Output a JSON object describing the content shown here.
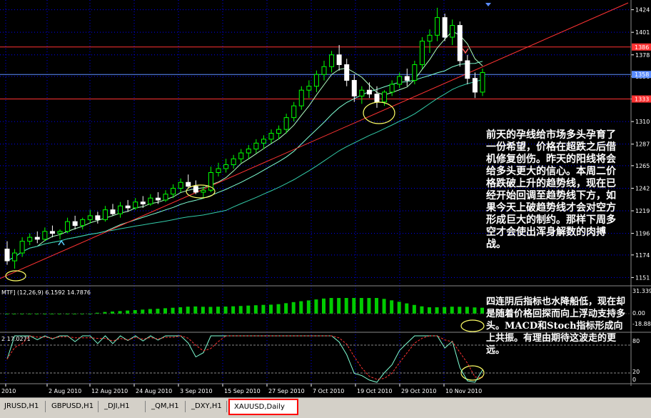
{
  "chart_data": {
    "type": "candlestick",
    "symbol_tab": "XAUUSD,Daily",
    "price_axis_ticks": [
      "1424",
      "1401",
      "1378",
      "1356",
      "1333",
      "1310",
      "1287",
      "1265",
      "1242",
      "1219",
      "1196",
      "1174",
      "1151"
    ],
    "price_labels": {
      "resistance": "1386",
      "current": "1358",
      "support": "1333"
    },
    "date_ticks": [
      "2010",
      "2 Aug 2010",
      "12 Aug 2010",
      "24 Aug 2010",
      "3 Sep 2010",
      "15 Sep 2010",
      "27 Sep 2010",
      "7 Oct 2010",
      "19 Oct 2010",
      "29 Oct 2010",
      "10 Nov 2010"
    ],
    "macd": {
      "label": "MTF] (12,26,9) 6.1592 14.7876",
      "ticks": [
        "31.339",
        "0.00",
        "-18.88"
      ]
    },
    "stoch": {
      "label": "2 17.0271",
      "ticks": [
        "80",
        "20",
        "0"
      ]
    },
    "candles": [
      [
        1180,
        1188,
        1164,
        1168
      ],
      [
        1168,
        1180,
        1160,
        1176
      ],
      [
        1176,
        1192,
        1172,
        1188
      ],
      [
        1188,
        1196,
        1184,
        1192
      ],
      [
        1192,
        1198,
        1186,
        1190
      ],
      [
        1190,
        1202,
        1188,
        1198
      ],
      [
        1198,
        1204,
        1192,
        1196
      ],
      [
        1196,
        1200,
        1190,
        1198
      ],
      [
        1198,
        1212,
        1196,
        1208
      ],
      [
        1208,
        1214,
        1200,
        1204
      ],
      [
        1204,
        1212,
        1200,
        1210
      ],
      [
        1210,
        1220,
        1206,
        1214
      ],
      [
        1214,
        1218,
        1206,
        1210
      ],
      [
        1210,
        1224,
        1208,
        1220
      ],
      [
        1220,
        1226,
        1214,
        1216
      ],
      [
        1216,
        1228,
        1212,
        1224
      ],
      [
        1224,
        1230,
        1218,
        1222
      ],
      [
        1222,
        1232,
        1220,
        1228
      ],
      [
        1228,
        1234,
        1222,
        1226
      ],
      [
        1226,
        1236,
        1224,
        1232
      ],
      [
        1232,
        1238,
        1226,
        1230
      ],
      [
        1230,
        1240,
        1228,
        1236
      ],
      [
        1236,
        1246,
        1232,
        1242
      ],
      [
        1242,
        1252,
        1238,
        1248
      ],
      [
        1248,
        1256,
        1242,
        1244
      ],
      [
        1244,
        1250,
        1236,
        1238
      ],
      [
        1238,
        1244,
        1232,
        1240
      ],
      [
        1240,
        1264,
        1238,
        1258
      ],
      [
        1258,
        1268,
        1254,
        1262
      ],
      [
        1262,
        1272,
        1258,
        1266
      ],
      [
        1266,
        1276,
        1262,
        1272
      ],
      [
        1272,
        1282,
        1268,
        1278
      ],
      [
        1278,
        1286,
        1272,
        1282
      ],
      [
        1282,
        1292,
        1278,
        1288
      ],
      [
        1288,
        1296,
        1282,
        1292
      ],
      [
        1292,
        1302,
        1288,
        1298
      ],
      [
        1298,
        1306,
        1292,
        1302
      ],
      [
        1302,
        1318,
        1298,
        1314
      ],
      [
        1314,
        1330,
        1310,
        1326
      ],
      [
        1326,
        1346,
        1322,
        1342
      ],
      [
        1342,
        1352,
        1334,
        1346
      ],
      [
        1346,
        1362,
        1340,
        1358
      ],
      [
        1358,
        1372,
        1352,
        1366
      ],
      [
        1366,
        1382,
        1360,
        1378
      ],
      [
        1378,
        1388,
        1362,
        1368
      ],
      [
        1368,
        1374,
        1346,
        1352
      ],
      [
        1352,
        1358,
        1330,
        1336
      ],
      [
        1336,
        1346,
        1328,
        1342
      ],
      [
        1342,
        1350,
        1334,
        1338
      ],
      [
        1338,
        1346,
        1324,
        1330
      ],
      [
        1330,
        1342,
        1326,
        1340
      ],
      [
        1340,
        1352,
        1336,
        1348
      ],
      [
        1348,
        1360,
        1344,
        1356
      ],
      [
        1356,
        1364,
        1346,
        1352
      ],
      [
        1352,
        1372,
        1348,
        1368
      ],
      [
        1368,
        1396,
        1364,
        1392
      ],
      [
        1392,
        1404,
        1380,
        1398
      ],
      [
        1398,
        1426,
        1392,
        1416
      ],
      [
        1416,
        1420,
        1392,
        1396
      ],
      [
        1396,
        1414,
        1388,
        1408
      ],
      [
        1408,
        1412,
        1366,
        1372
      ],
      [
        1372,
        1378,
        1348,
        1354
      ],
      [
        1354,
        1360,
        1334,
        1340
      ],
      [
        1340,
        1364,
        1336,
        1360
      ]
    ]
  },
  "tabs": [
    "JRUSD,H1",
    "GBPUSD,H1",
    "_DJI,H1",
    "_QM,H1",
    "_DXY,H1",
    "XAUUSD,Daily"
  ],
  "annotations": {
    "main": "前天的孕线给市场多头孕育了一份希望，价格在超跌之后借机修复创伤。昨天的阳线将会给多头更大的信心。本周二价格跌破上升的趋势线，现在已经开始回调至趋势线下方，如果今天上破趋势线才会对空方形成巨大的制约。那样下周多空才会使出浑身解数的肉搏战。",
    "lower": "四连阴后指标也水降船低，现在却是随着价格回探而向上浮动支持多头。MACD和Stoch指标形成向上共振。有理由期待这波走的更远。"
  },
  "colors": {
    "background": "#000000",
    "bull": "#00ff00",
    "bear": "#ffffff",
    "trendline": "#ff3333",
    "ma_fast": "#b0ffc0",
    "ma_mid": "#7fffd4",
    "ma_slow": "#33ccaa",
    "grid": "#0000ff",
    "highlight_ring": "#ffff66",
    "macd_pos": "#00cc00",
    "macd_neg": "#ff0000"
  }
}
